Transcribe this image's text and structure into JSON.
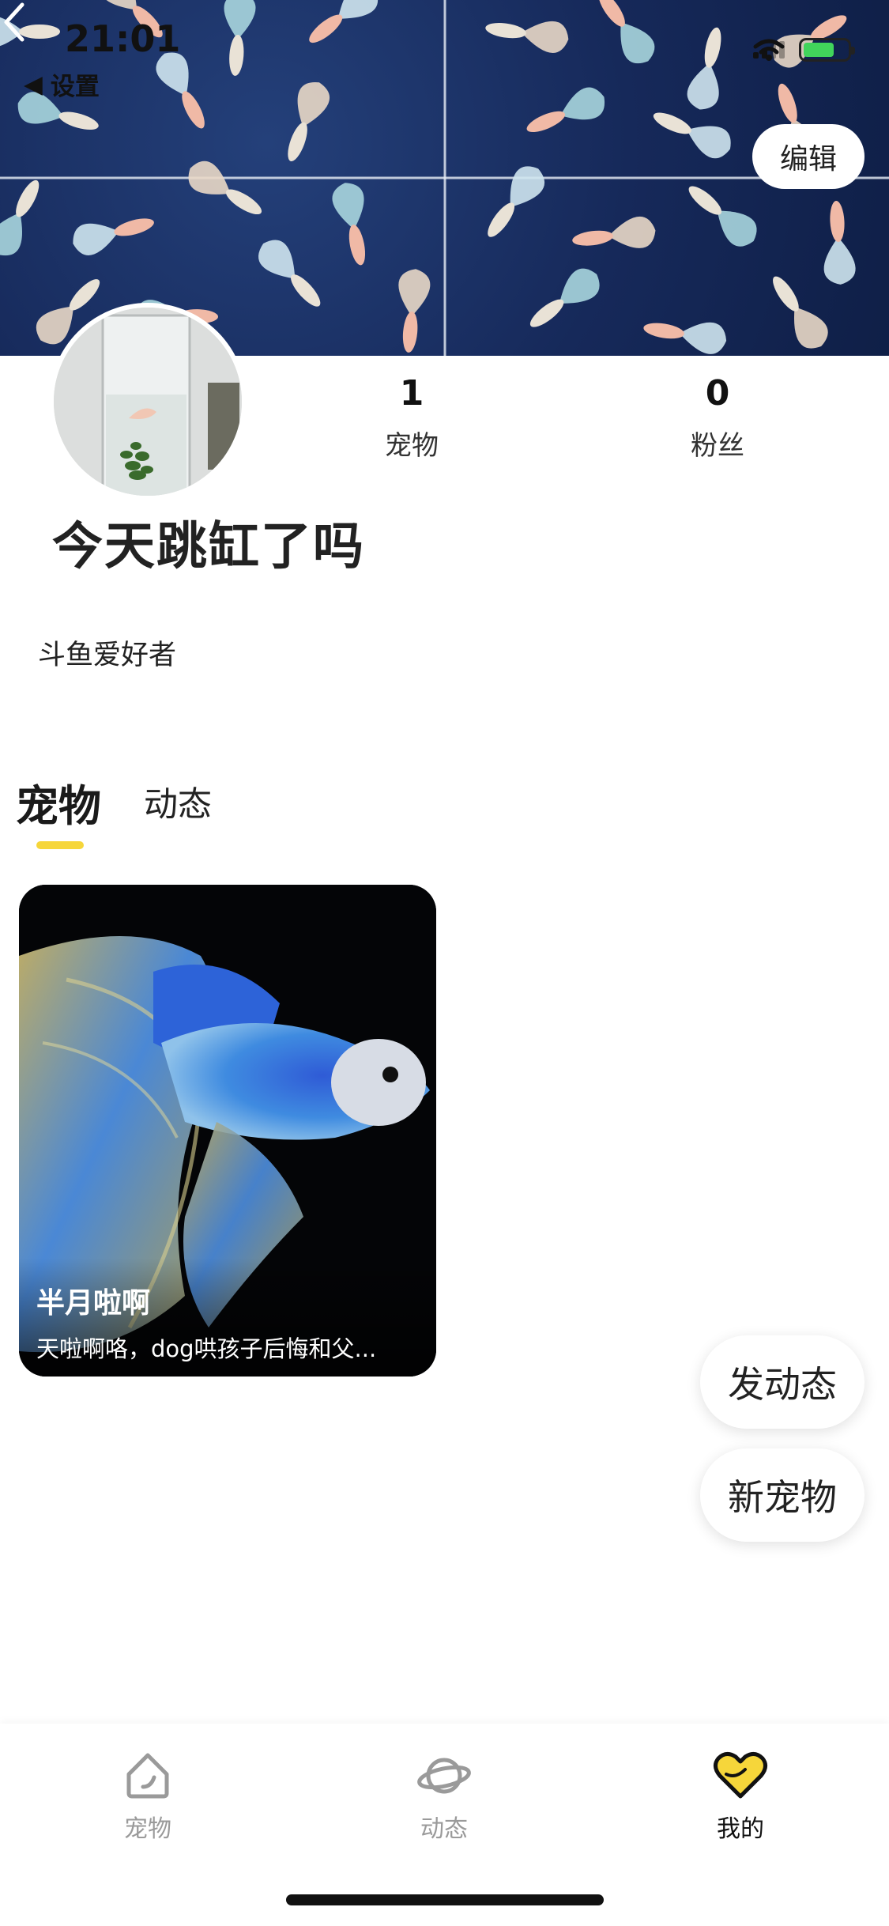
{
  "status_bar": {
    "time": "21:01",
    "back_app": "设置"
  },
  "header": {
    "edit_label": "编辑"
  },
  "profile": {
    "username": "今天跳缸了吗",
    "bio": "斗鱼爱好者",
    "stats": [
      {
        "value": "1",
        "label": "宠物"
      },
      {
        "value": "0",
        "label": "粉丝"
      }
    ]
  },
  "tabs": [
    {
      "label": "宠物",
      "active": true
    },
    {
      "label": "动态",
      "active": false
    }
  ],
  "pet_cards": [
    {
      "name": "半月啦啊",
      "desc": "天啦啊咯，dog哄孩子后悔和父..."
    }
  ],
  "fabs": {
    "post_label": "发动态",
    "new_pet_label": "新宠物"
  },
  "bottom_nav": [
    {
      "label": "宠物",
      "icon": "pet-house-icon",
      "active": false
    },
    {
      "label": "动态",
      "icon": "planet-icon",
      "active": false
    },
    {
      "label": "我的",
      "icon": "heart-icon",
      "active": true
    }
  ],
  "colors": {
    "accent": "#f6d63a",
    "inactive": "#9a9a9a"
  }
}
